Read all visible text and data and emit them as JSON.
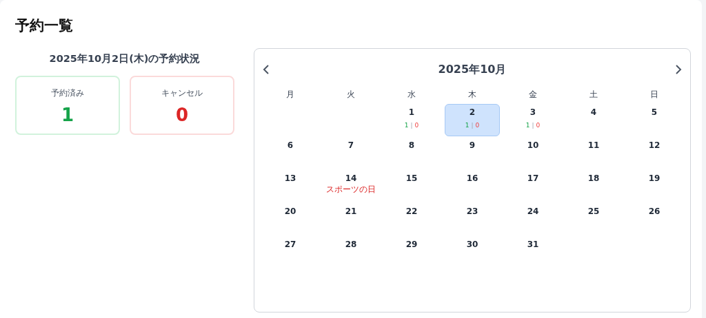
{
  "title": "予約一覧",
  "summary": {
    "heading": "2025年10月2日(木)の予約状況",
    "cards": [
      {
        "kind": "booked",
        "label": "予約済み",
        "value": "1"
      },
      {
        "kind": "cancelled",
        "label": "キャンセル",
        "value": "0"
      }
    ]
  },
  "calendar": {
    "month": "2025年10月",
    "count_separator": "|",
    "weekdays": [
      "月",
      "火",
      "水",
      "木",
      "金",
      "土",
      "日"
    ],
    "weeks": [
      [
        {
          "kind": "empty"
        },
        {
          "kind": "empty"
        },
        {
          "kind": "day",
          "day": "1",
          "selected": false,
          "booked": "1",
          "cancelled": "0"
        },
        {
          "kind": "day",
          "day": "2",
          "selected": true,
          "booked": "1",
          "cancelled": "0"
        },
        {
          "kind": "day",
          "day": "3",
          "selected": false,
          "booked": "1",
          "cancelled": "0"
        },
        {
          "kind": "day",
          "day": "4",
          "selected": false
        },
        {
          "kind": "day",
          "day": "5",
          "selected": false
        }
      ],
      [
        {
          "kind": "day",
          "day": "6",
          "selected": false
        },
        {
          "kind": "day",
          "day": "7",
          "selected": false
        },
        {
          "kind": "day",
          "day": "8",
          "selected": false
        },
        {
          "kind": "day",
          "day": "9",
          "selected": false
        },
        {
          "kind": "day",
          "day": "10",
          "selected": false
        },
        {
          "kind": "day",
          "day": "11",
          "selected": false
        },
        {
          "kind": "day",
          "day": "12",
          "selected": false
        }
      ],
      [
        {
          "kind": "day",
          "day": "13",
          "selected": false
        },
        {
          "kind": "day",
          "day": "14",
          "selected": false,
          "holiday": "スポーツの日"
        },
        {
          "kind": "day",
          "day": "15",
          "selected": false
        },
        {
          "kind": "day",
          "day": "16",
          "selected": false
        },
        {
          "kind": "day",
          "day": "17",
          "selected": false
        },
        {
          "kind": "day",
          "day": "18",
          "selected": false
        },
        {
          "kind": "day",
          "day": "19",
          "selected": false
        }
      ],
      [
        {
          "kind": "day",
          "day": "20",
          "selected": false
        },
        {
          "kind": "day",
          "day": "21",
          "selected": false
        },
        {
          "kind": "day",
          "day": "22",
          "selected": false
        },
        {
          "kind": "day",
          "day": "23",
          "selected": false
        },
        {
          "kind": "day",
          "day": "24",
          "selected": false
        },
        {
          "kind": "day",
          "day": "25",
          "selected": false
        },
        {
          "kind": "day",
          "day": "26",
          "selected": false
        }
      ],
      [
        {
          "kind": "day",
          "day": "27",
          "selected": false
        },
        {
          "kind": "day",
          "day": "28",
          "selected": false
        },
        {
          "kind": "day",
          "day": "29",
          "selected": false
        },
        {
          "kind": "day",
          "day": "30",
          "selected": false
        },
        {
          "kind": "day",
          "day": "31",
          "selected": false
        },
        {
          "kind": "empty"
        },
        {
          "kind": "empty"
        }
      ]
    ]
  }
}
